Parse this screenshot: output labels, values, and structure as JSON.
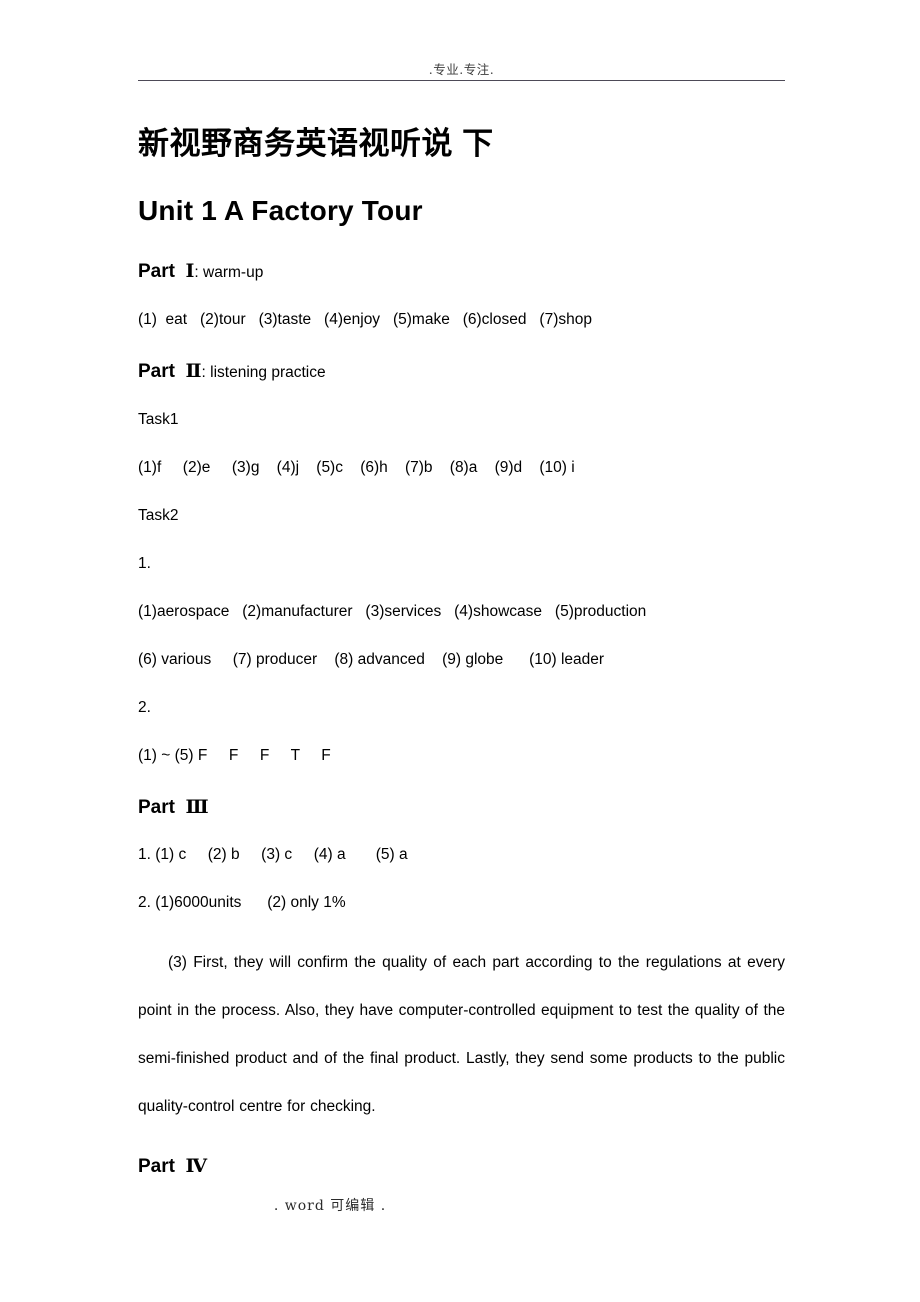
{
  "header": {
    "text": ".专业.专注."
  },
  "document": {
    "title_cn": "新视野商务英语视听说 下",
    "title_en": "Unit 1 A Factory Tour"
  },
  "part1": {
    "heading": "Part Ⅰ",
    "heading_label": "Part",
    "numeral": "Ⅰ",
    "subtitle": ": warm-up",
    "answers": "(1)  eat   (2)tour   (3)taste   (4)enjoy   (5)make   (6)closed   (7)shop"
  },
  "part2": {
    "heading_label": "Part",
    "numeral": "Ⅱ",
    "subtitle": ": listening practice",
    "task1_label": "Task1",
    "task1_answers": "(1)f     (2)e     (3)g    (4)j    (5)c    (6)h    (7)b    (8)a    (9)d    (10) i",
    "task2_label": "Task2",
    "item1_number": "1.",
    "item1_line1": "(1)aerospace   (2)manufacturer   (3)services   (4)showcase   (5)production",
    "item1_line2": "(6) various     (7) producer    (8) advanced    (9) globe      (10) leader",
    "item2_number": "2.",
    "item2_line1": "(1) ~ (5) F     F     F     T     F"
  },
  "part3": {
    "heading_label": "Part",
    "numeral": "Ⅲ",
    "line1": "1. (1) c     (2) b     (3) c     (4) a       (5) a",
    "line2": "2. (1)6000units      (2) only 1%",
    "paragraph": "(3) First, they will confirm the quality of each part according to the regulations at every point in the process. Also, they have computer-controlled equipment to test the quality of the semi-finished product and of the final product. Lastly, they send some products to the public quality-control centre for checking."
  },
  "part4": {
    "heading_label": "Part",
    "numeral": "Ⅳ"
  },
  "footer": {
    "text": ".   word 可编辑   ."
  }
}
